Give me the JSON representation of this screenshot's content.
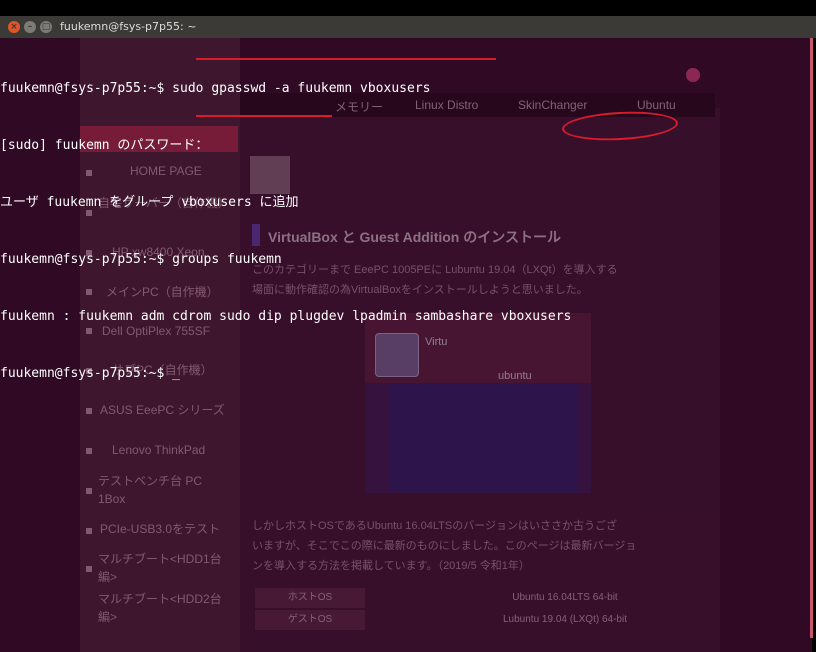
{
  "window": {
    "title": "fuukemn@fsys-p7p55: ~"
  },
  "terminal": {
    "lines": [
      "fuukemn@fsys-p7p55:~$ sudo gpasswd -a fuukemn vboxusers",
      "[sudo] fuukemn のパスワード：",
      "ユーザ fuukemn をグループ vboxusers に追加",
      "fuukemn@fsys-p7p55:~$ groups fuukemn",
      "fuukemn : fuukemn adm cdrom sudo dip plugdev lpadmin sambashare vboxusers",
      "fuukemn@fsys-p7p55:~$ _"
    ],
    "highlight_color": "#d81c2c"
  },
  "background_page": {
    "nav": [
      "メモリー",
      "Linux Distro",
      "SkinChanger",
      "Ubuntu"
    ],
    "sidebar": [
      "HOME PAGE",
      "自宅サーバー（自作機）",
      "HP xw8400 Xeon",
      "メインPC（自作機）",
      "Dell OptiPlex 755SF",
      "サブPC（自作機）",
      "ASUS EeePC シリーズ",
      "Lenovo ThinkPad",
      "テストベンチ台 PC 1Box",
      "PCIe-USB3.0をテスト",
      "マルチブート<HDD1台編>",
      "マルチブート<HDD2台編>"
    ],
    "article_title": "VirtualBox と Guest Addition のインストール",
    "intro": [
      "このカテゴリーまで EeePC 1005PEに Lubuntu 19.04（LXQt）を導入する",
      "場面に動作確認の為VirtualBoxをインストールしようと思いました。"
    ],
    "image_labels": [
      "Virtu",
      "ubuntu"
    ],
    "body": [
      "しかしホストOSであるUbuntu 16.04LTSのバージョンはいささか古うござ",
      "いますが、そこでこの際に最新のものにしました。このページは最新バージョ",
      "ンを導入する方法を掲載しています。（2019/5 令和1年）"
    ],
    "table": [
      {
        "key": "ホストOS",
        "value": "Ubuntu 16.04LTS 64-bit"
      },
      {
        "key": "ゲストOS",
        "value": "Lubuntu 19.04 (LXQt) 64-bit"
      }
    ]
  }
}
